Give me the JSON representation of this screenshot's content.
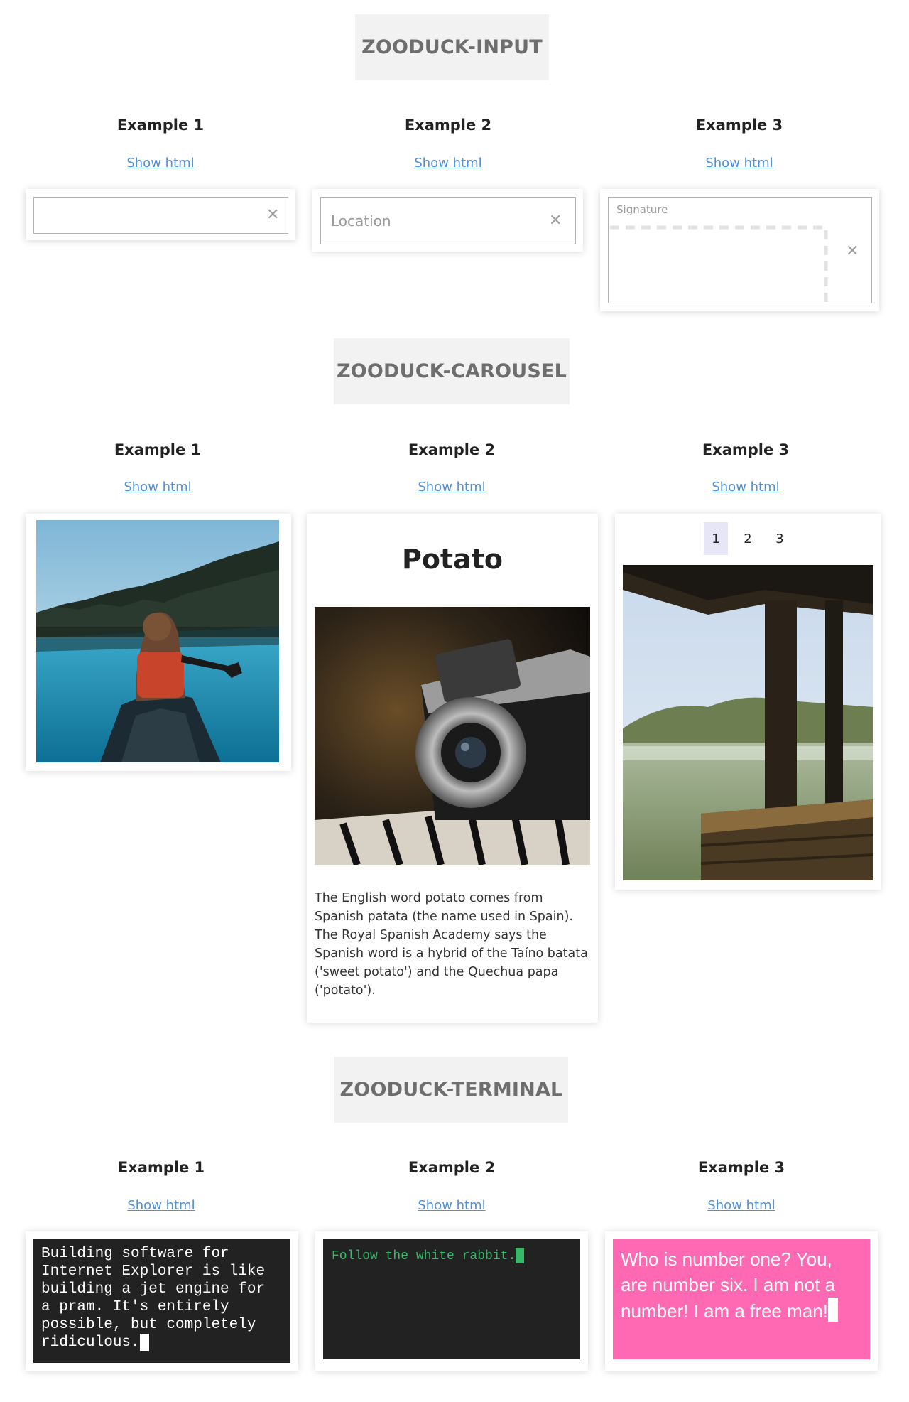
{
  "sections": {
    "input": {
      "title": "ZOODUCK-INPUT",
      "examples": [
        {
          "heading": "Example 1",
          "link": "Show html",
          "value": "",
          "placeholder": ""
        },
        {
          "heading": "Example 2",
          "link": "Show html",
          "value": "",
          "placeholder": "Location"
        },
        {
          "heading": "Example 3",
          "link": "Show html",
          "label": "Signature"
        }
      ],
      "clear_glyph": "✕"
    },
    "carousel": {
      "title": "ZOODUCK-CAROUSEL",
      "examples": [
        {
          "heading": "Example 1",
          "link": "Show html"
        },
        {
          "heading": "Example 2",
          "link": "Show html",
          "slide_title": "Potato",
          "slide_text": "The English word potato comes from Spanish patata (the name used in Spain). The Royal Spanish Academy says the Spanish word is a hybrid of the Taíno batata ('sweet potato') and the Quechua papa ('potato')."
        },
        {
          "heading": "Example 3",
          "link": "Show html",
          "pages": [
            "1",
            "2",
            "3"
          ],
          "active_page": "1"
        }
      ]
    },
    "terminal": {
      "title": "ZOODUCK-TERMINAL",
      "examples": [
        {
          "heading": "Example 1",
          "link": "Show html",
          "text": "Building software for Internet Explorer is like building a jet engine for a pram. It's entirely possible, but completely ridiculous.",
          "text_color": "#ffffff",
          "background": "#222222"
        },
        {
          "heading": "Example 2",
          "link": "Show html",
          "text": "Follow the white rabbit.",
          "text_color": "#3ab86a",
          "background": "#222222"
        },
        {
          "heading": "Example 3",
          "link": "Show html",
          "text": "Who is number one? You, are number six. I am not a number! I am a free man!",
          "text_color": "#ffffff",
          "background": "#ff69b4"
        }
      ]
    }
  },
  "colors": {
    "link": "#4f8fd6",
    "title_bg": "#f2f2f2",
    "title_text": "#6e6e6e"
  }
}
